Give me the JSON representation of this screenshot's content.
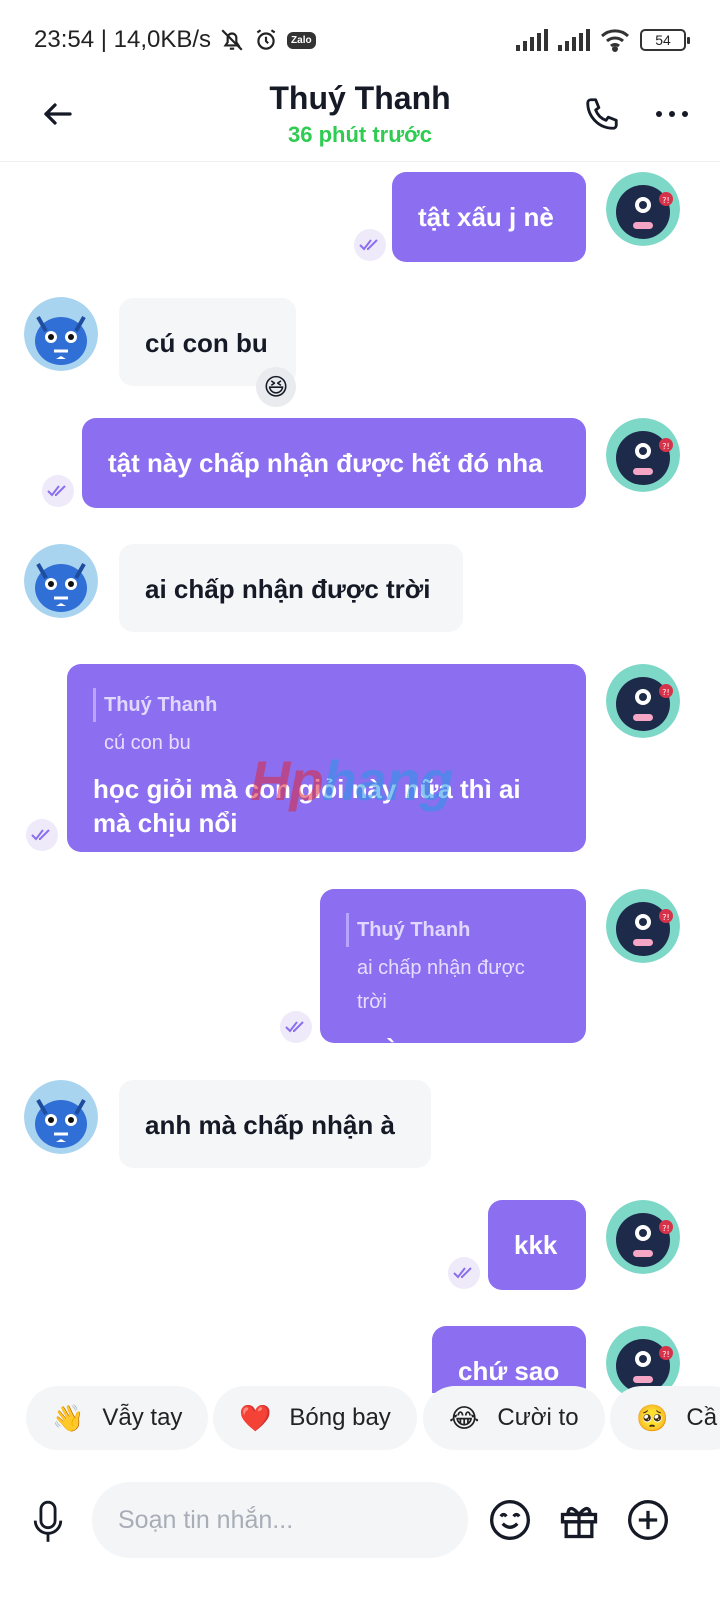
{
  "status_bar": {
    "time_speed": "23:54 | 14,0KB/s",
    "zalo": "Zalo",
    "battery": "54"
  },
  "header": {
    "title": "Thuý Thanh",
    "subtitle": "36 phút trước"
  },
  "messages": [
    {
      "dir": "out",
      "text": "tật xấu j nè"
    },
    {
      "dir": "in",
      "text": "cú con bu",
      "reaction": "😆"
    },
    {
      "dir": "out",
      "text": "tật này chấp nhận được hết đó nha"
    },
    {
      "dir": "in",
      "text": "ai chấp nhận được trời"
    },
    {
      "dir": "out",
      "quote_name": "Thuý Thanh",
      "quote_text": "cú con bu",
      "text": "học giỏi mà con giỏi này nữa thì ai mà chịu nổi"
    },
    {
      "dir": "out",
      "quote_name": "Thuý Thanh",
      "quote_text": "ai chấp nhận được trời",
      "text": "a nè"
    },
    {
      "dir": "in",
      "text": "anh mà chấp nhận à"
    },
    {
      "dir": "out",
      "text": "kkk"
    },
    {
      "dir": "out",
      "text": "chứ sao"
    }
  ],
  "watermark": {
    "part1": "Hp",
    "part2": "hang"
  },
  "chips": [
    {
      "emoji": "👋",
      "label": "Vẫy tay"
    },
    {
      "emoji": "❤️",
      "label": "Bóng bay"
    },
    {
      "emoji": "😂",
      "label": "Cười to"
    },
    {
      "emoji": "🥺",
      "label": "Cầ"
    }
  ],
  "composer": {
    "placeholder": "Soạn tin nhắn..."
  },
  "icons": {
    "back": "arrow-left-icon",
    "call": "phone-icon",
    "more": "more-dots-icon",
    "mic": "microphone-icon",
    "emoji": "emoji-icon",
    "gift": "gift-icon",
    "add": "plus-circle-icon",
    "seen": "double-check-icon"
  },
  "colors": {
    "outgoing_bubble": "#8c6ff0",
    "incoming_bubble": "#f5f6f8",
    "online_status": "#2ecc50"
  }
}
